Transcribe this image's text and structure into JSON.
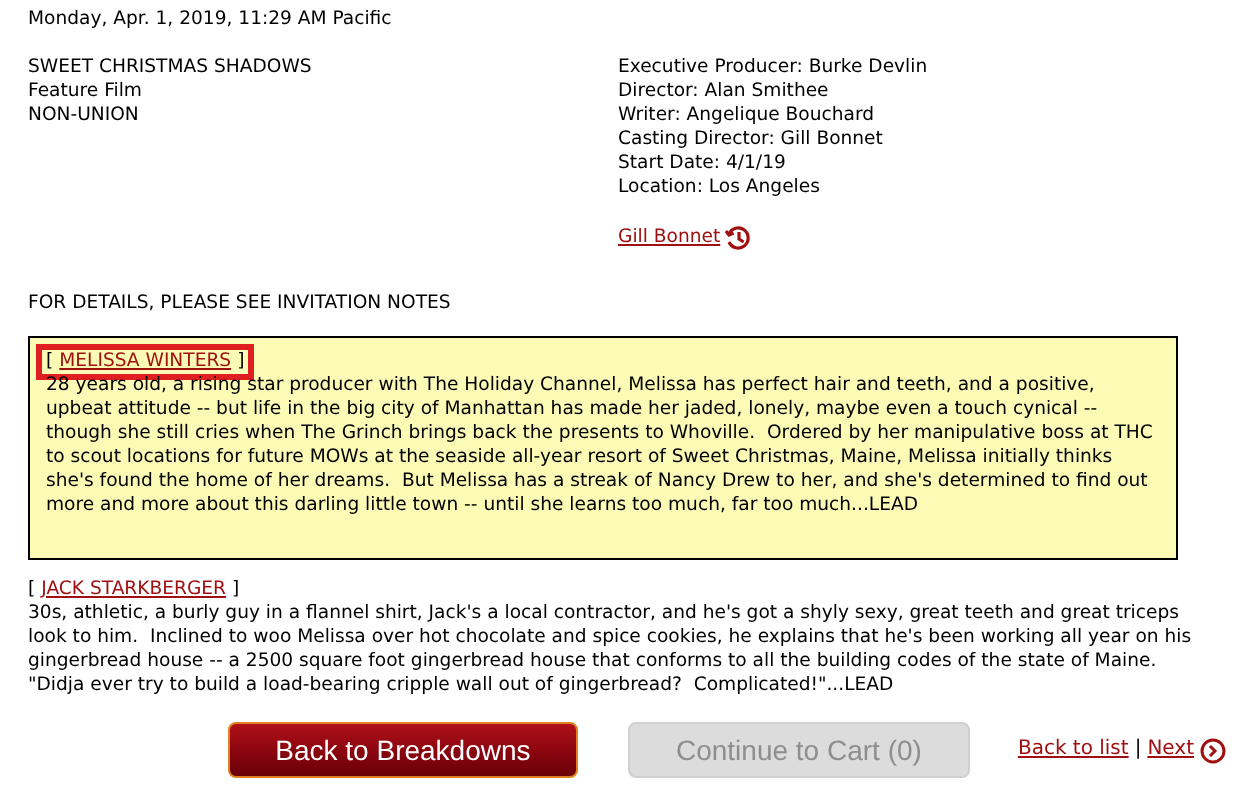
{
  "timestamp": "Monday, Apr. 1, 2019, 11:29 AM Pacific",
  "project": {
    "title": "SWEET CHRISTMAS SHADOWS",
    "type": "Feature Film",
    "union": "NON-UNION"
  },
  "credits": [
    "Executive Producer: Burke Devlin",
    "Director: Alan Smithee",
    "Writer: Angelique Bouchard",
    "Casting Director: Gill Bonnet",
    "Start Date: 4/1/19",
    "Location: Los Angeles"
  ],
  "casting_director_link": "Gill Bonnet",
  "notice": "FOR DETAILS, PLEASE SEE INVITATION NOTES",
  "roles": [
    {
      "open": "[",
      "name": "MELISSA WINTERS",
      "close": "]",
      "selected": true,
      "description": "28 years old, a rising star producer with The Holiday Channel, Melissa has perfect hair and teeth, and a positive, upbeat attitude -- but life in the big city of Manhattan has made her jaded, lonely, maybe even a touch cynical -- though she still cries when The Grinch brings back the presents to Whoville.  Ordered by her manipulative boss at THC to scout locations for future MOWs at the seaside all-year resort of Sweet Christmas, Maine, Melissa initially thinks she's found the home of her dreams.  But Melissa has a streak of Nancy Drew to her, and she's determined to find out more and more about this darling little town -- until she learns too much, far too much...LEAD"
    },
    {
      "open": "[",
      "name": "JACK STARKBERGER",
      "close": "]",
      "selected": false,
      "description": "30s, athletic, a burly guy in a flannel shirt, Jack's a local contractor, and he's got a shyly sexy, great teeth and great triceps look to him.  Inclined to woo Melissa over hot chocolate and spice cookies, he explains that he's been working all year on his gingerbread house -- a 2500 square foot gingerbread house that conforms to all the building codes of the state of Maine.  \"Didja ever try to build a load-bearing cripple wall out of gingerbread?  Complicated!\"...LEAD"
    }
  ],
  "buttons": [
    {
      "label": "Back to Breakdowns",
      "disabled": false
    },
    {
      "label": "Continue to Cart (0)",
      "disabled": true
    }
  ],
  "nav_links": [
    "Back to list",
    "Next"
  ],
  "nav_separator": "|"
}
